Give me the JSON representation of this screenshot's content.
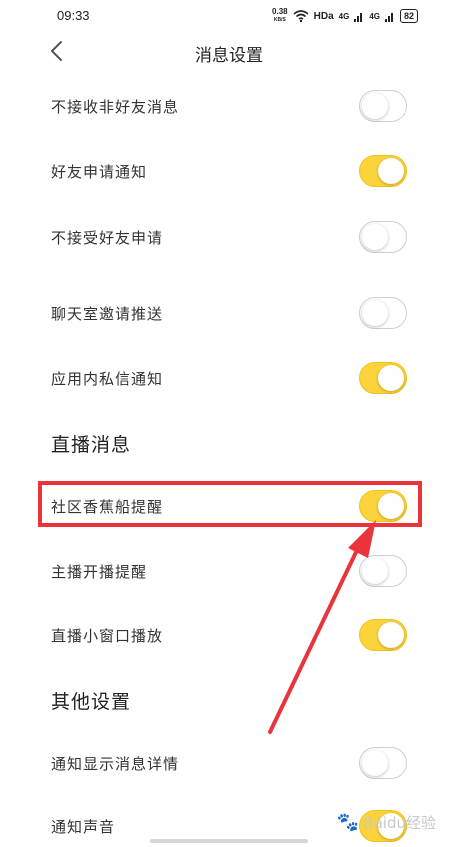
{
  "status": {
    "time": "09:33",
    "speed_value": "0.38",
    "speed_unit": "KB/S",
    "hd": "HDa",
    "sig1": "4G",
    "sig2": "4G",
    "battery": "82"
  },
  "header": {
    "title": "消息设置"
  },
  "rows_top": [
    {
      "label": "不接收非好友消息",
      "on": false
    },
    {
      "label": "好友申请通知",
      "on": true
    },
    {
      "label": "不接受好友申请",
      "on": false
    },
    {
      "label": "聊天室邀请推送",
      "on": false
    },
    {
      "label": "应用内私信通知",
      "on": true
    }
  ],
  "section_live": {
    "title": "直播消息"
  },
  "rows_live": [
    {
      "label": "社区香蕉船提醒",
      "on": true
    },
    {
      "label": "主播开播提醒",
      "on": false
    },
    {
      "label": "直播小窗口播放",
      "on": true
    }
  ],
  "section_other": {
    "title": "其他设置"
  },
  "rows_other": [
    {
      "label": "通知显示消息详情",
      "on": false
    },
    {
      "label": "通知声音",
      "on": true
    }
  ],
  "watermark": {
    "text": "Baidu经验"
  },
  "colors": {
    "toggle_on": "#fbd43c",
    "toggle_off": "#ffffff",
    "highlight": "#e8343a"
  }
}
